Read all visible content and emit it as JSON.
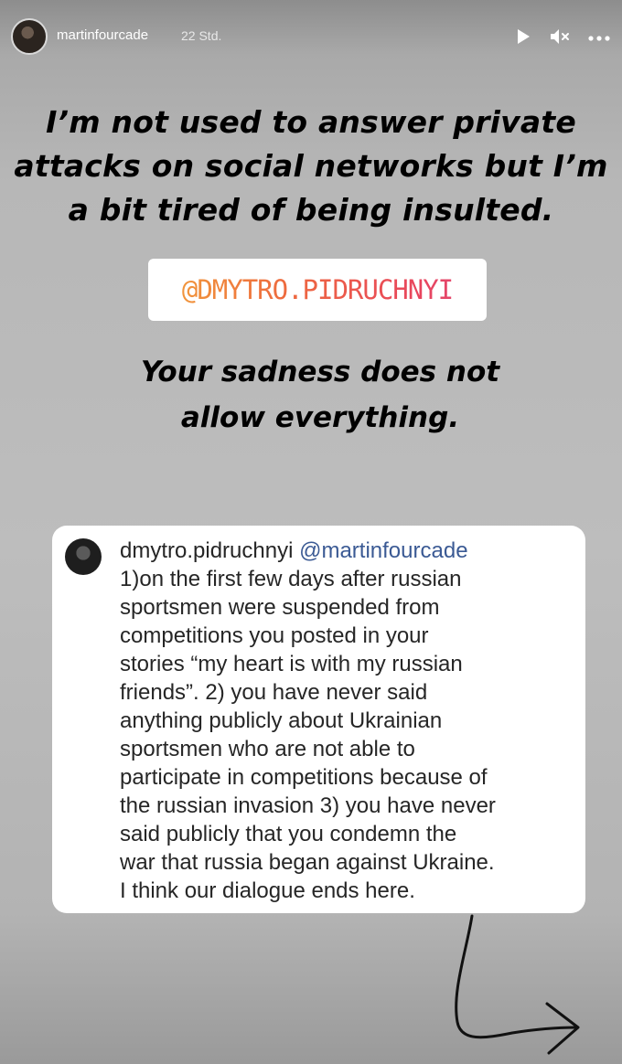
{
  "header": {
    "username": "martinfourcade",
    "timestamp": "22 Std."
  },
  "story": {
    "headline_lines": [
      "I’m not used to answer private",
      "attacks on social networks but I’m",
      "a bit tired of being insulted."
    ],
    "mention_sticker": "@DMYTRO.PIDRUCHNYI",
    "subline_lines": [
      "Your sadness does not",
      "allow everything."
    ]
  },
  "quote": {
    "username": "dmytro.pidruchnyi",
    "mention": "@martinfourcade",
    "lines": [
      "1)on the first few days after russian",
      "sportsmen were suspended from",
      "competitions you posted in your",
      "stories “my heart is with my russian",
      "friends”. 2) you have never said",
      "anything publicly about Ukrainian",
      "sportsmen who are not able to",
      "participate in competitions because of",
      "the russian invasion 3) you have never",
      "said publicly that you condemn the",
      "war that russia began against Ukraine.",
      "I think our dialogue ends here."
    ]
  },
  "icons": {
    "play": "play-icon",
    "mute": "mute-icon",
    "more": "more-icon",
    "arrow": "arrow-icon"
  }
}
